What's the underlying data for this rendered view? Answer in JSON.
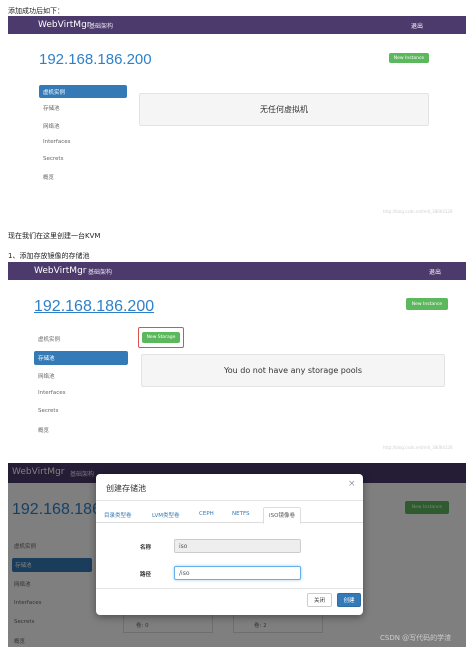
{
  "captions": {
    "intro": "添加成功后如下：",
    "create_kvm": "现在我们在这里创建一台KVM",
    "step1": "1、添加存放镜像的存储池"
  },
  "shot1": {
    "brand": "WebVirtMgr",
    "nav": "基础架构",
    "logout": "退出",
    "host": "192.168.186.200",
    "new_instance": "New Instance",
    "sidebar": [
      "虚机实例",
      "存储池",
      "网络池",
      "Interfaces",
      "Secrets",
      "概览"
    ],
    "empty_msg": "无任何虚拟机",
    "watermark": "http://blog.csdn.net/m0_38064128"
  },
  "shot2": {
    "brand": "WebVirtMgr",
    "nav": "基础架构",
    "logout": "退出",
    "host": "192.168.186.200",
    "new_instance": "New Instance",
    "new_storage": "New Storage",
    "sidebar": [
      "虚机实例",
      "存储池",
      "网络池",
      "Interfaces",
      "Secrets",
      "概览"
    ],
    "empty_msg": "You do not have any storage pools",
    "watermark": "http://blog.csdn.net/m0_38064128"
  },
  "shot3": {
    "brand": "WebVirtMgr",
    "nav": "基础架构",
    "host": "192.168.186.200",
    "new_instance": "New Instance",
    "sidebar": [
      "虚机实例",
      "存储池",
      "网络池",
      "Interfaces",
      "Secrets",
      "概览"
    ],
    "pool_label_a": "卷: 0",
    "pool_label_b": "卷: 2",
    "modal": {
      "title": "创建存储池",
      "close": "×",
      "tabs": [
        "目录类型卷",
        "LVM类型卷",
        "CEPH",
        "NETFS",
        "ISO镜像卷"
      ],
      "name_label": "名称",
      "name_value": "iso",
      "path_label": "路径",
      "path_value": "/iso",
      "cancel": "关闭",
      "submit": "创建"
    },
    "watermark": "CSDN @写代码的学渣"
  }
}
